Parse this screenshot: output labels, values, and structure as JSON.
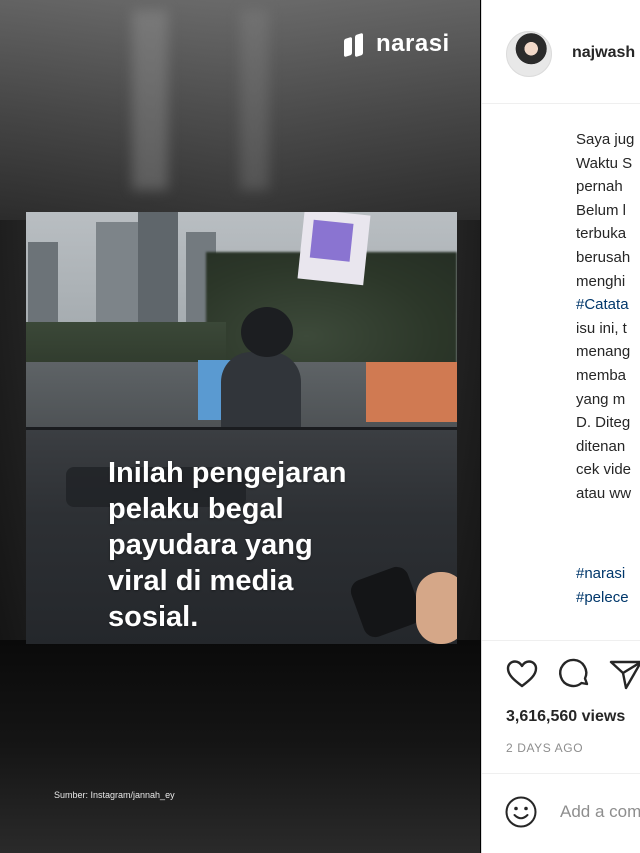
{
  "media": {
    "brand": "narasi",
    "caption": "Inilah pengejaran\npelaku begal\npayudara yang\nviral di media\nsosial.",
    "source": "Sumber: Instagram/jannah_ey"
  },
  "post": {
    "username": "najwash",
    "body_lines": [
      {
        "text": "Saya jug",
        "tag": false
      },
      {
        "text": "Waktu S",
        "tag": false
      },
      {
        "text": "pernah",
        "tag": false
      },
      {
        "text": "Belum l",
        "tag": false
      },
      {
        "text": "terbuka",
        "tag": false
      },
      {
        "text": "berusah",
        "tag": false
      },
      {
        "text": "menghi",
        "tag": false
      },
      {
        "text": "#Catata",
        "tag": true
      },
      {
        "text": "isu ini, t",
        "tag": false
      },
      {
        "text": "menang",
        "tag": false
      },
      {
        "text": "memba",
        "tag": false
      },
      {
        "text": "yang m",
        "tag": false
      },
      {
        "text": "D. Diteg",
        "tag": false
      },
      {
        "text": "ditenan",
        "tag": false
      },
      {
        "text": "cek vide",
        "tag": false
      },
      {
        "text": "atau ww",
        "tag": false
      }
    ],
    "hashtags": [
      "#narasi",
      "#pelece"
    ],
    "views": "3,616,560 views",
    "date": "2 DAYS AGO",
    "comment_placeholder": "Add a comment..."
  },
  "icons": [
    "heart-icon",
    "comment-icon",
    "share-icon",
    "emoji-icon"
  ],
  "colors": {
    "hashtag": "#00376b",
    "text": "#262626",
    "muted": "#8e8e8e",
    "border": "#dbdbdb"
  }
}
